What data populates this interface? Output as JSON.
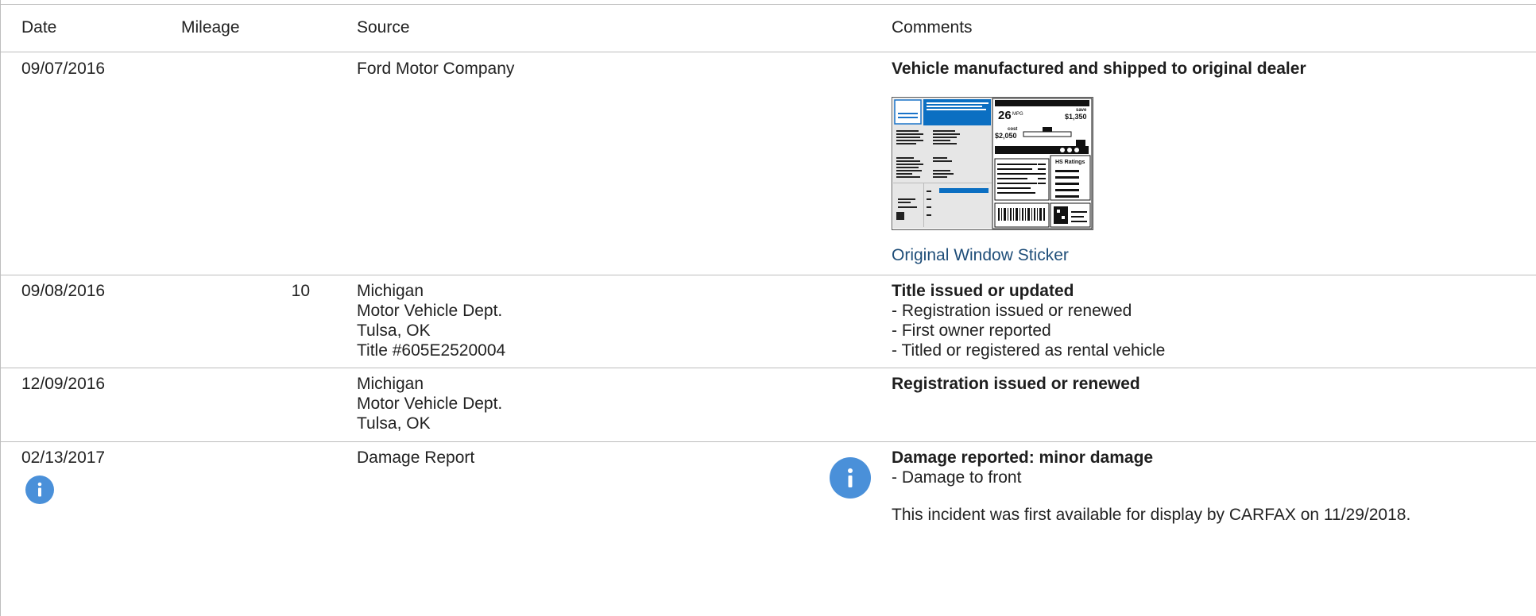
{
  "headers": {
    "date": "Date",
    "mileage": "Mileage",
    "source": "Source",
    "comments": "Comments"
  },
  "rows": [
    {
      "date": "09/07/2016",
      "mileage": "",
      "source": [
        "Ford Motor Company"
      ],
      "comment_title": "Vehicle manufactured and shipped to original dealer",
      "comment_items": [],
      "sticker": {
        "link_label": "Original Window Sticker",
        "mpg": "26",
        "mpg_unit": "MPG",
        "save_label": "save",
        "save_amount": "$1,350",
        "cost_label": "cost",
        "cost_amount": "$2,050",
        "ratings_label": "HS Ratings"
      }
    },
    {
      "date": "09/08/2016",
      "mileage": "10",
      "source": [
        "Michigan",
        "Motor Vehicle Dept.",
        "Tulsa, OK",
        "Title #605E2520004"
      ],
      "comment_title": "Title issued or updated",
      "comment_items": [
        "- Registration issued or renewed",
        "- First owner reported",
        "- Titled or registered as rental vehicle"
      ]
    },
    {
      "date": "12/09/2016",
      "mileage": "",
      "source": [
        "Michigan",
        "Motor Vehicle Dept.",
        "Tulsa, OK"
      ],
      "comment_title": "Registration issued or renewed",
      "comment_items": []
    },
    {
      "date": "02/13/2017",
      "mileage": "",
      "source": [
        "Damage Report"
      ],
      "comment_title": "Damage reported: minor damage",
      "comment_items": [
        "- Damage to front"
      ],
      "note": "This incident was first available for display by CARFAX on 11/29/2018."
    }
  ],
  "colors": {
    "info_icon": "#4a90d9",
    "link": "#1f4e79",
    "divider": "#bdbdbd"
  },
  "icons": {
    "row4_date_icon": "info-icon",
    "row4_comment_icon": "info-icon"
  }
}
